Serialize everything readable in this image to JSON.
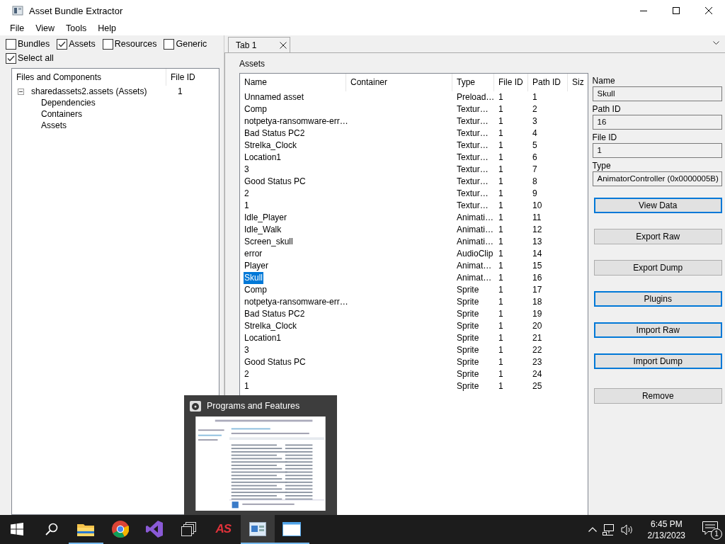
{
  "window": {
    "title": "Asset Bundle Extractor"
  },
  "menu": [
    "File",
    "View",
    "Tools",
    "Help"
  ],
  "filters": [
    {
      "label": "Bundles",
      "checked": false
    },
    {
      "label": "Assets",
      "checked": true
    },
    {
      "label": "Resources",
      "checked": false
    },
    {
      "label": "Generic",
      "checked": false
    }
  ],
  "select_all": {
    "label": "Select all",
    "checked": true
  },
  "tree": {
    "columns": [
      "Files and Components",
      "File ID"
    ],
    "items": [
      {
        "name": "sharedassets2.assets (Assets)",
        "file_id": "1",
        "expanded": true,
        "children": [
          {
            "name": "Dependencies"
          },
          {
            "name": "Containers"
          },
          {
            "name": "Assets"
          }
        ]
      }
    ]
  },
  "tabs": [
    {
      "label": "Tab 1",
      "selected": true
    }
  ],
  "assets": {
    "title": "Assets",
    "columns": [
      "Name",
      "Container",
      "Type",
      "File ID",
      "Path ID",
      "Siz"
    ],
    "rows": [
      {
        "name": "Unnamed asset",
        "type": "Preload…",
        "file_id": "1",
        "path_id": "1",
        "selected": false
      },
      {
        "name": "Comp",
        "type": "Textur…",
        "file_id": "1",
        "path_id": "2",
        "selected": false
      },
      {
        "name": "notpetya-ransomware-err…",
        "type": "Textur…",
        "file_id": "1",
        "path_id": "3",
        "selected": false
      },
      {
        "name": "Bad Status PC2",
        "type": "Textur…",
        "file_id": "1",
        "path_id": "4",
        "selected": false
      },
      {
        "name": "Strelka_Clock",
        "type": "Textur…",
        "file_id": "1",
        "path_id": "5",
        "selected": false
      },
      {
        "name": "Location1",
        "type": "Textur…",
        "file_id": "1",
        "path_id": "6",
        "selected": false
      },
      {
        "name": "3",
        "type": "Textur…",
        "file_id": "1",
        "path_id": "7",
        "selected": false
      },
      {
        "name": "Good Status PC",
        "type": "Textur…",
        "file_id": "1",
        "path_id": "8",
        "selected": false
      },
      {
        "name": "2",
        "type": "Textur…",
        "file_id": "1",
        "path_id": "9",
        "selected": false
      },
      {
        "name": "1",
        "type": "Textur…",
        "file_id": "1",
        "path_id": "10",
        "selected": false
      },
      {
        "name": "Idle_Player",
        "type": "Animati…",
        "file_id": "1",
        "path_id": "11",
        "selected": false
      },
      {
        "name": "Idle_Walk",
        "type": "Animati…",
        "file_id": "1",
        "path_id": "12",
        "selected": false
      },
      {
        "name": "Screen_skull",
        "type": "Animati…",
        "file_id": "1",
        "path_id": "13",
        "selected": false
      },
      {
        "name": "error",
        "type": "AudioClip",
        "file_id": "1",
        "path_id": "14",
        "selected": false
      },
      {
        "name": "Player",
        "type": "Animat…",
        "file_id": "1",
        "path_id": "15",
        "selected": false
      },
      {
        "name": "Skull",
        "type": "Animat…",
        "file_id": "1",
        "path_id": "16",
        "selected": true
      },
      {
        "name": "Comp",
        "type": "Sprite",
        "file_id": "1",
        "path_id": "17",
        "selected": false
      },
      {
        "name": "notpetya-ransomware-err…",
        "type": "Sprite",
        "file_id": "1",
        "path_id": "18",
        "selected": false
      },
      {
        "name": "Bad Status PC2",
        "type": "Sprite",
        "file_id": "1",
        "path_id": "19",
        "selected": false
      },
      {
        "name": "Strelka_Clock",
        "type": "Sprite",
        "file_id": "1",
        "path_id": "20",
        "selected": false
      },
      {
        "name": "Location1",
        "type": "Sprite",
        "file_id": "1",
        "path_id": "21",
        "selected": false
      },
      {
        "name": "3",
        "type": "Sprite",
        "file_id": "1",
        "path_id": "22",
        "selected": false
      },
      {
        "name": "Good Status PC",
        "type": "Sprite",
        "file_id": "1",
        "path_id": "23",
        "selected": false
      },
      {
        "name": "2",
        "type": "Sprite",
        "file_id": "1",
        "path_id": "24",
        "selected": false
      },
      {
        "name": "1",
        "type": "Sprite",
        "file_id": "1",
        "path_id": "25",
        "selected": false
      }
    ]
  },
  "details": {
    "fields": [
      {
        "label": "Name",
        "value": "Skull"
      },
      {
        "label": "Path ID",
        "value": "16"
      },
      {
        "label": "File ID",
        "value": "1"
      },
      {
        "label": "Type",
        "value": "AnimatorController (0x0000005B)"
      }
    ],
    "buttons": [
      {
        "label": "View Data",
        "focused": true
      },
      {
        "label": "Export Raw",
        "focused": false
      },
      {
        "label": "Export Dump",
        "focused": false
      },
      {
        "label": "Plugins",
        "focused": true
      },
      {
        "label": "Import Raw",
        "focused": true
      },
      {
        "label": "Import Dump",
        "focused": true
      },
      {
        "label": "Remove",
        "focused": false
      }
    ]
  },
  "preview": {
    "title": "Programs and Features"
  },
  "taskbar": {
    "items": [
      {
        "kind": "start",
        "running": false,
        "active": false
      },
      {
        "kind": "search",
        "running": false,
        "active": false
      },
      {
        "kind": "explorer",
        "running": true,
        "active": false
      },
      {
        "kind": "browser",
        "running": false,
        "active": false
      },
      {
        "kind": "studio",
        "running": false,
        "active": false
      },
      {
        "kind": "taskview",
        "running": false,
        "active": false
      },
      {
        "kind": "text-logo",
        "label": "AS",
        "running": false,
        "active": false
      },
      {
        "kind": "extractor",
        "running": true,
        "active": true
      },
      {
        "kind": "window",
        "running": true,
        "active": false
      }
    ],
    "time": "6:45 PM",
    "date": "2/13/2023",
    "notifications": "1"
  }
}
